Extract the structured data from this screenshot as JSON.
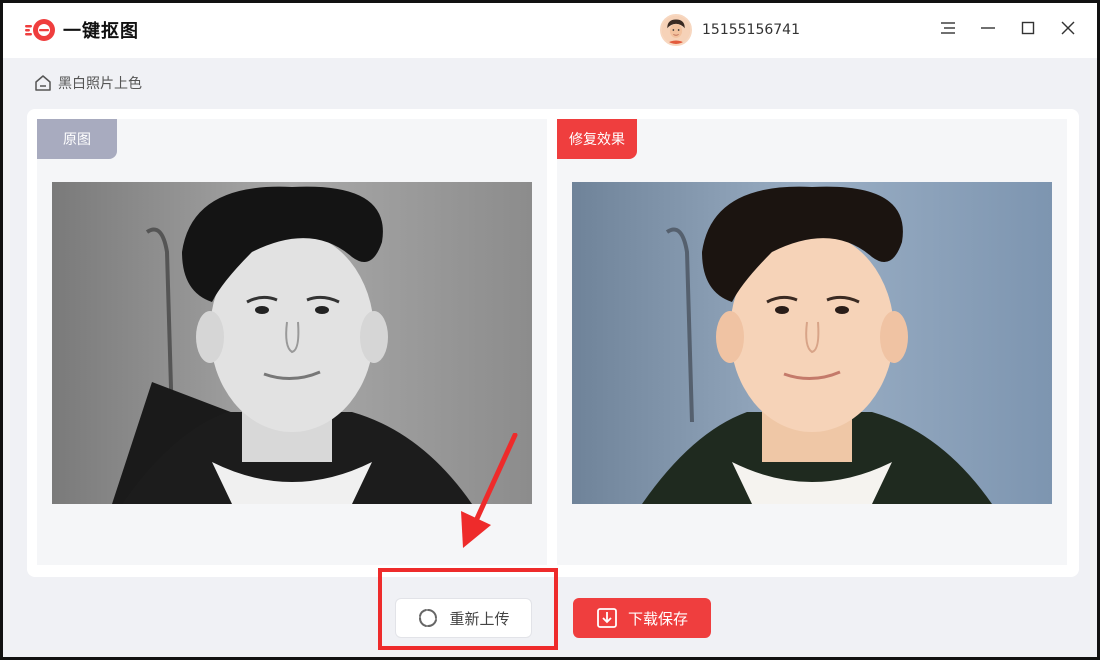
{
  "app": {
    "name": "一键抠图",
    "accent_color": "#ef3e3e",
    "logo_icon": "app-logo-icon"
  },
  "user": {
    "phone": "15155156741",
    "avatar_icon": "user-avatar"
  },
  "window_controls": {
    "menu_icon": "menu-icon",
    "minimize_icon": "minimize-icon",
    "maximize_icon": "maximize-icon",
    "close_icon": "close-icon"
  },
  "breadcrumb": {
    "icon": "home-icon",
    "label": "黑白照片上色"
  },
  "compare": {
    "original_label": "原图",
    "result_label": "修复效果",
    "original_tag_color": "#a8abbf",
    "result_tag_color": "#ef3e3e"
  },
  "actions": {
    "reupload_label": "重新上传",
    "reupload_icon": "refresh-icon",
    "download_label": "下载保存",
    "download_icon": "download-icon"
  }
}
